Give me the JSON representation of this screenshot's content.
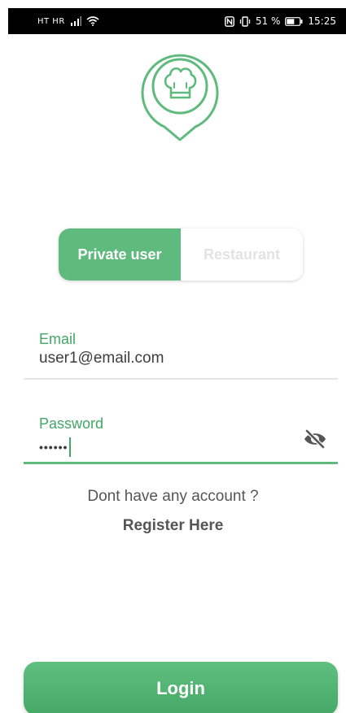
{
  "status_bar": {
    "carrier": "HT HR",
    "battery_percent": "51 %",
    "time": "15:25"
  },
  "user_type_toggle": {
    "options": [
      "Private user",
      "Restaurant"
    ],
    "selected": "Private user"
  },
  "email_field": {
    "label": "Email",
    "value": "user1@email.com"
  },
  "password_field": {
    "label": "Password",
    "masked_value": "••••••"
  },
  "signup_prompt": {
    "text": "Dont have any account ?",
    "link": "Register Here"
  },
  "login_button": {
    "label": "Login"
  },
  "colors": {
    "accent": "#5fba7d",
    "accent_text": "#43a664",
    "inactive_text": "#e3e3e3",
    "body_text": "#555555"
  },
  "icons": {
    "logo": "chef-hat-location-pin-icon",
    "password_toggle": "eye-off-icon"
  }
}
